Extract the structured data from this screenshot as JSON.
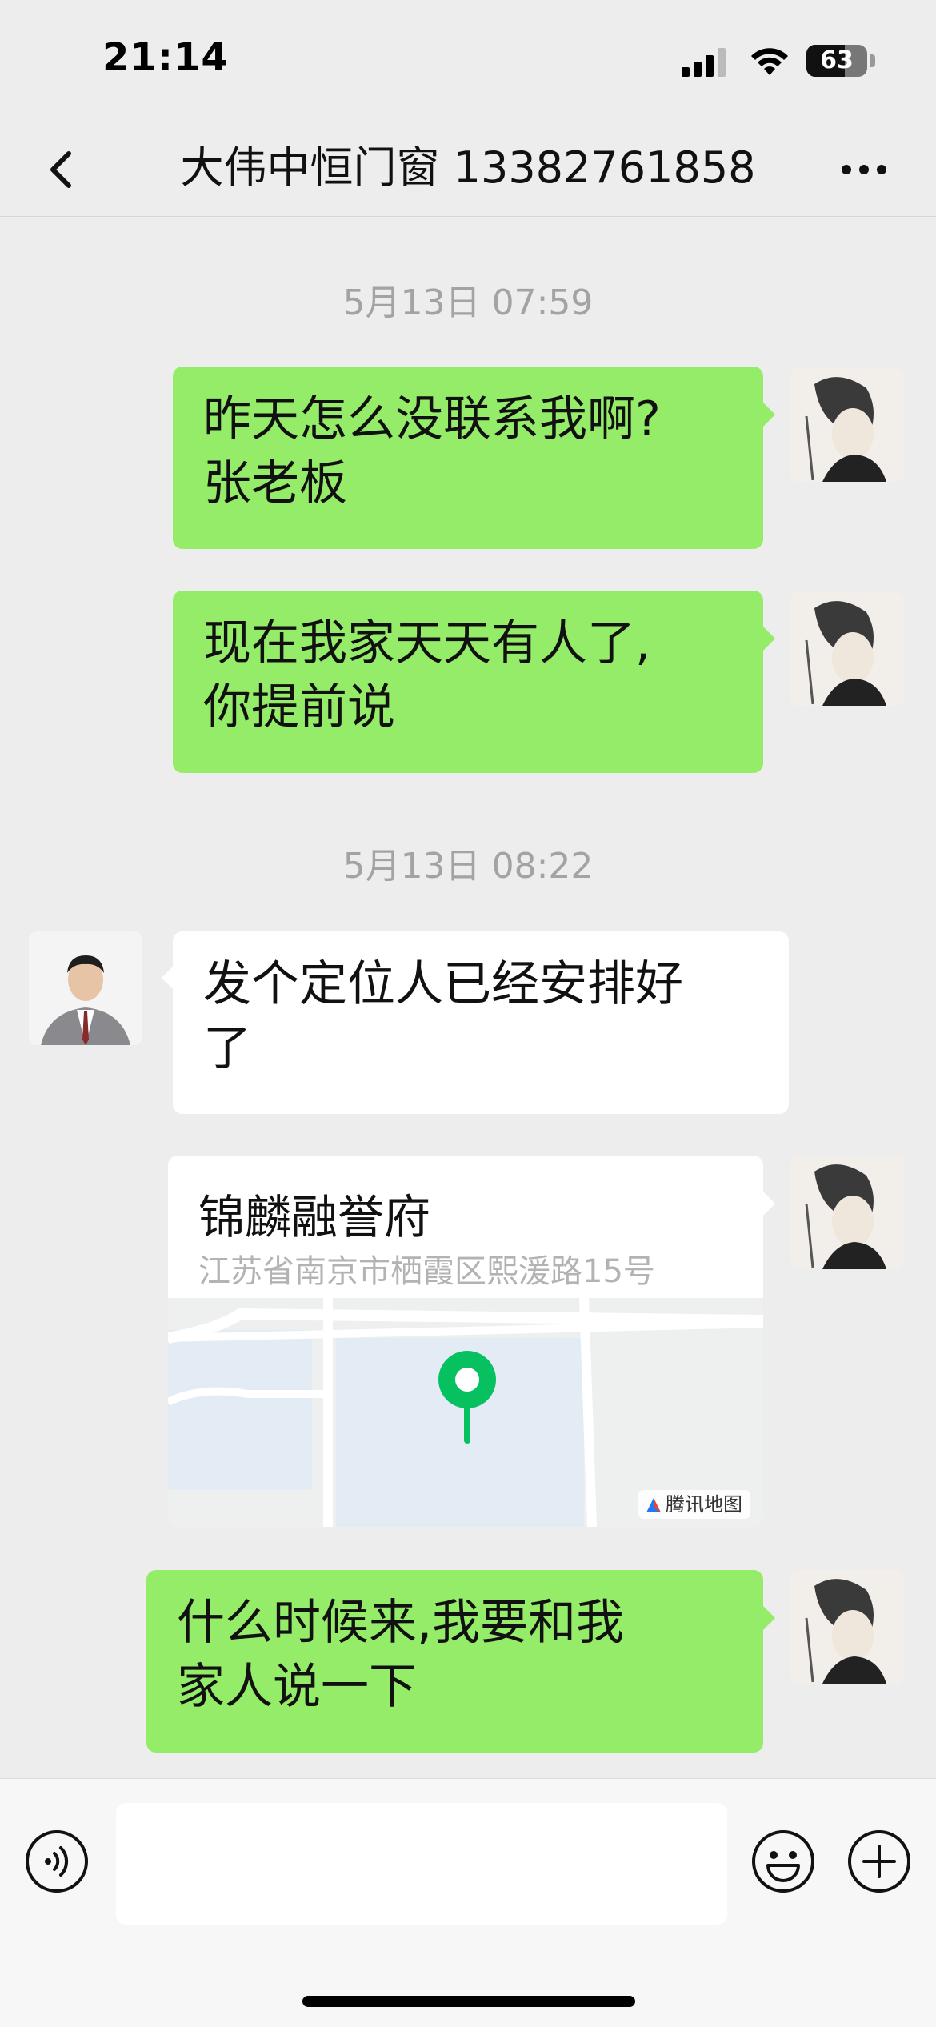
{
  "status_bar": {
    "time": "21:14",
    "battery": "63",
    "battery_level_percent": 63
  },
  "header": {
    "title": "大伟中恒门窗 13382761858",
    "back_icon": "chevron-left-icon",
    "more_icon": "more-dots-icon"
  },
  "messages": [
    {
      "type": "timestamp",
      "text": "5月13日 07:59"
    },
    {
      "type": "text",
      "from": "self",
      "lines": [
        "昨天怎么没联系我啊?",
        "张老板"
      ]
    },
    {
      "type": "text",
      "from": "self",
      "lines": [
        "现在我家天天有人了,",
        "你提前说"
      ]
    },
    {
      "type": "timestamp",
      "text": "5月13日 08:22"
    },
    {
      "type": "text",
      "from": "contact",
      "lines": [
        "发个定位人已经安排好",
        "了"
      ]
    },
    {
      "type": "location",
      "from": "self",
      "name": "锦麟融誉府",
      "address": "江苏省南京市栖霞区熙湲路15号",
      "provider": "腾讯地图"
    },
    {
      "type": "text",
      "from": "self",
      "lines": [
        "什么时候来,我要和我",
        "家人说一下"
      ]
    }
  ],
  "input_bar": {
    "voice_icon": "voice-icon",
    "emoji_icon": "emoji-icon",
    "plus_icon": "plus-icon",
    "text_value": ""
  },
  "colors": {
    "background": "#ededed",
    "self_bubble": "#95ec69",
    "contact_bubble": "#ffffff",
    "timestamp_text": "#a3a3a3",
    "map_pin": "#07c160"
  }
}
